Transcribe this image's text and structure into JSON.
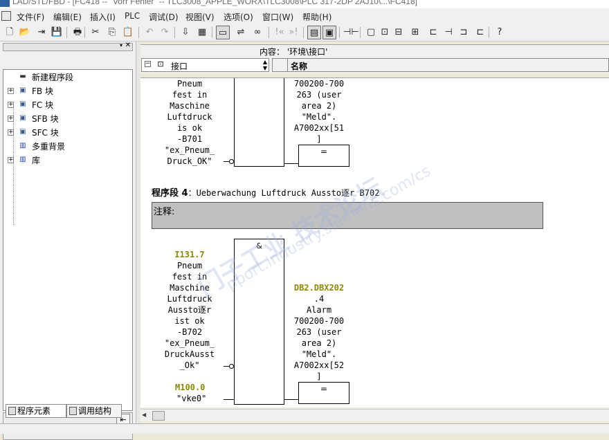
{
  "window": {
    "title": "LAD/STL/FBD  - [FC418 -- \"Vorr Fehler\" -- TLC3008_APPLE_WORX\\TLC3008\\PLC 317-2DP 2AJ10\\...\\FC418]"
  },
  "menu": [
    "文件(F)",
    "编辑(E)",
    "插入(I)",
    "PLC",
    "调试(D)",
    "视图(V)",
    "选项(O)",
    "窗口(W)",
    "帮助(H)"
  ],
  "toolbar": {
    "items": [
      {
        "name": "new-icon",
        "glyph": "🗋"
      },
      {
        "name": "open-icon",
        "glyph": "📂"
      },
      {
        "name": "accessible-icon",
        "glyph": "⇥"
      },
      {
        "name": "save-icon",
        "glyph": "💾"
      },
      {
        "name": "print-icon",
        "glyph": "🖶"
      },
      {
        "name": "cut-icon",
        "glyph": "✂"
      },
      {
        "name": "copy-icon",
        "glyph": "⎘"
      },
      {
        "name": "paste-icon",
        "glyph": "📋"
      },
      {
        "name": "undo-icon",
        "glyph": "↶"
      },
      {
        "name": "redo-icon",
        "glyph": "↷"
      },
      {
        "name": "download-icon",
        "glyph": "⇩"
      },
      {
        "name": "online-icon",
        "glyph": "▦"
      },
      {
        "name": "monitor-icon",
        "glyph": "▭"
      },
      {
        "name": "network-icon",
        "glyph": "⇌"
      },
      {
        "name": "glasses-icon",
        "glyph": "∞"
      },
      {
        "name": "jump-icon",
        "glyph": "!«"
      },
      {
        "name": "jump-next-icon",
        "glyph": "»!"
      },
      {
        "name": "overview-icon",
        "glyph": "▤"
      },
      {
        "name": "details-icon",
        "glyph": "▣"
      },
      {
        "name": "nc-contact-icon",
        "glyph": "⊣⊢"
      },
      {
        "name": "box-icon",
        "glyph": "▢"
      },
      {
        "name": "box2-icon",
        "glyph": "⊡"
      },
      {
        "name": "box3-icon",
        "glyph": "⊟"
      },
      {
        "name": "box4-icon",
        "glyph": "⊞"
      },
      {
        "name": "branch-open-icon",
        "glyph": "⊏"
      },
      {
        "name": "branch-icon",
        "glyph": "⊣"
      },
      {
        "name": "branch-close-icon",
        "glyph": "⊐"
      },
      {
        "name": "contact-icon",
        "glyph": "⊏"
      },
      {
        "name": "help-icon",
        "glyph": "?"
      }
    ]
  },
  "left_panel": {
    "tree": [
      {
        "label": "新建程序段",
        "icon": "▬",
        "expandable": false
      },
      {
        "label": "FB 块",
        "icon": "▣",
        "expandable": true
      },
      {
        "label": "FC 块",
        "icon": "▣",
        "expandable": true
      },
      {
        "label": "SFB 块",
        "icon": "▣",
        "expandable": true
      },
      {
        "label": "SFC 块",
        "icon": "▣",
        "expandable": true
      },
      {
        "label": "多重背景",
        "icon": "▥",
        "expandable": false
      },
      {
        "label": "库",
        "icon": "▥",
        "expandable": true
      }
    ],
    "tabs": [
      "程序元素",
      "调用结构"
    ]
  },
  "interface": {
    "content_label": "内容： '环境\\接口'",
    "combo_value": "接口",
    "column_name": "名称"
  },
  "network3": {
    "input_lines": [
      "Pneum",
      "fest in",
      "Maschine",
      "Luftdruck",
      "is ok",
      "-B701",
      "\"ex_Pneum_",
      "Druck_OK\""
    ],
    "output_lines": [
      "700200-700",
      "263 (user",
      "area 2)",
      "\"Meld\".",
      "A7002xx[51",
      "]"
    ],
    "coil": "="
  },
  "network4": {
    "title_bold": "程序段 4",
    "title_rest": "：Ueberwachung Luftdruck Aussto逐r B702",
    "comment_label": "注释:",
    "and_label": "&",
    "input_address": "I131.7",
    "input_lines": [
      "Pneum",
      "fest in",
      "Maschine",
      "Luftdruck",
      "Aussto逐r",
      "ist ok",
      "-B702",
      "\"ex_Pneum_",
      "DruckAusst",
      "_Ok\""
    ],
    "second_address": "M100.0",
    "second_symbol": "\"vke0\"",
    "output_address": "DB2.DBX202",
    "output_lines": [
      ".4",
      "Alarm",
      "700200-700",
      "263 (user",
      "area 2)",
      "\"Meld\".",
      "A7002xx[52",
      "]"
    ],
    "coil": "="
  },
  "watermark": {
    "text_cn": "门子工业 技术论坛",
    "text_url": "pport.industry.siemens.com/cs"
  }
}
